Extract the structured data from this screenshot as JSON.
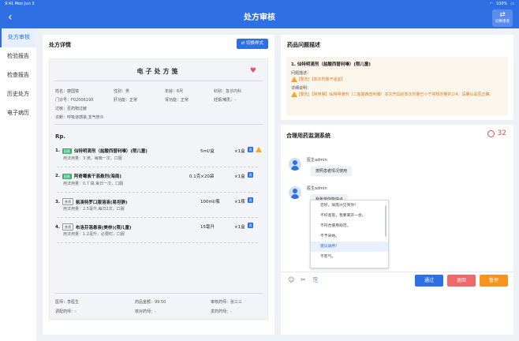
{
  "status_bar": {
    "time": "9:41",
    "date": "Mon Jun 3",
    "battery": "100%"
  },
  "header": {
    "back_glyph": "‹",
    "title": "处方审核",
    "switch_label": "切换患者",
    "switch_icon_glyph": "⇄"
  },
  "sidebar": {
    "items": [
      {
        "label": "处方审核"
      },
      {
        "label": "检验报告"
      },
      {
        "label": "检查报告"
      },
      {
        "label": "历史处方"
      },
      {
        "label": "电子病历"
      }
    ]
  },
  "prescription": {
    "panel_title": "处方详情",
    "switch_style_label": "⇄ 切换样式",
    "title": "电子处方笺",
    "heart_glyph": "♥",
    "patient": {
      "name": "姓名：康国猿",
      "gender": "性别：男",
      "age": "年龄：6月",
      "dept": "科别：急诊内科",
      "outpatient_no": "门诊号：F0200619X",
      "liver": "肝功能：正常",
      "kidney": "肾功能：正常",
      "pregnant": "妊娠/哺乳：-",
      "allergy": "过敏：否药物过敏",
      "diagnosis": "诊断：呼吸道感染,支气管炎"
    },
    "rp_label": "Rp.",
    "drugs": [
      {
        "index": "1.",
        "tag": "国基",
        "name": "仙特明滴剂（盐酸西替利嗪）(限儿童)",
        "spec": "5ml/盒",
        "qty": "×1盒",
        "usage": "用法用量：3 滴，每晚一次，口服"
      },
      {
        "index": "2.",
        "tag": "国基",
        "name": "阿奇霉素干混悬剂(海南)",
        "spec": "0.1克×20袋",
        "qty": "×1盒",
        "usage": "用法用量：0.7 袋,每日一次，口服"
      },
      {
        "index": "3.",
        "tag": "普通",
        "name": "氨溴特罗口服溶液(易坦静)",
        "spec": "100ml/瓶",
        "qty": "×1瓶",
        "usage": "用法用量：2.5毫升,每日2次，口服"
      },
      {
        "index": "4.",
        "tag": "普通",
        "name": "布洛芬混悬液(美林)(限儿童)",
        "spec": "15毫升",
        "qty": "×1盒",
        "usage": "用法用量：1.2毫升，必要时，口服"
      }
    ],
    "icon_label": "说",
    "footer": {
      "doctor": "医师：李医生",
      "amount": "药品金额：99.50",
      "reviewer": "审核药师：张三三",
      "dispenser": "调配药师：-",
      "checker": "核对药师：-",
      "issuer": "发药药师：-"
    }
  },
  "issues": {
    "panel_title": "药品问题描述",
    "heading": "1. 仙特明滴剂（盐酸西替利嗪）(限儿童)",
    "problem_label": "问题描述：",
    "problem": "[警告]【单次剂量不适宜】",
    "detail_label": "详细说明：",
    "detail": "[警告]【常用量】仙特明滴剂（二盐酸西替利嗪）本次开具的单次剂量已小于常规剂量的1/4。请确认是否正确。"
  },
  "chat": {
    "panel_title": "合理用药监测系统",
    "timer": "32",
    "messages": [
      {
        "sender": "医生admin",
        "text": "我希望你能快点"
      },
      {
        "sender": "医生admin",
        "text": "按照患者情况使用"
      }
    ],
    "quick_replies": [
      "您好，很高兴见到你!",
      "不好意思，我要离开一会。",
      "不符合使用规范。",
      "不予采纳。",
      "建议填用!",
      "不客气。"
    ],
    "toolbar": {
      "emoji_glyph": "☺",
      "scissor_glyph": "✂",
      "reply_glyph": "⎘"
    },
    "actions": {
      "pass": "通过",
      "reject": "退回",
      "pause": "暂停"
    },
    "colors": {
      "pass": "#2f6fe4",
      "reject": "#ee6a6a",
      "pause": "#f7941d"
    }
  }
}
